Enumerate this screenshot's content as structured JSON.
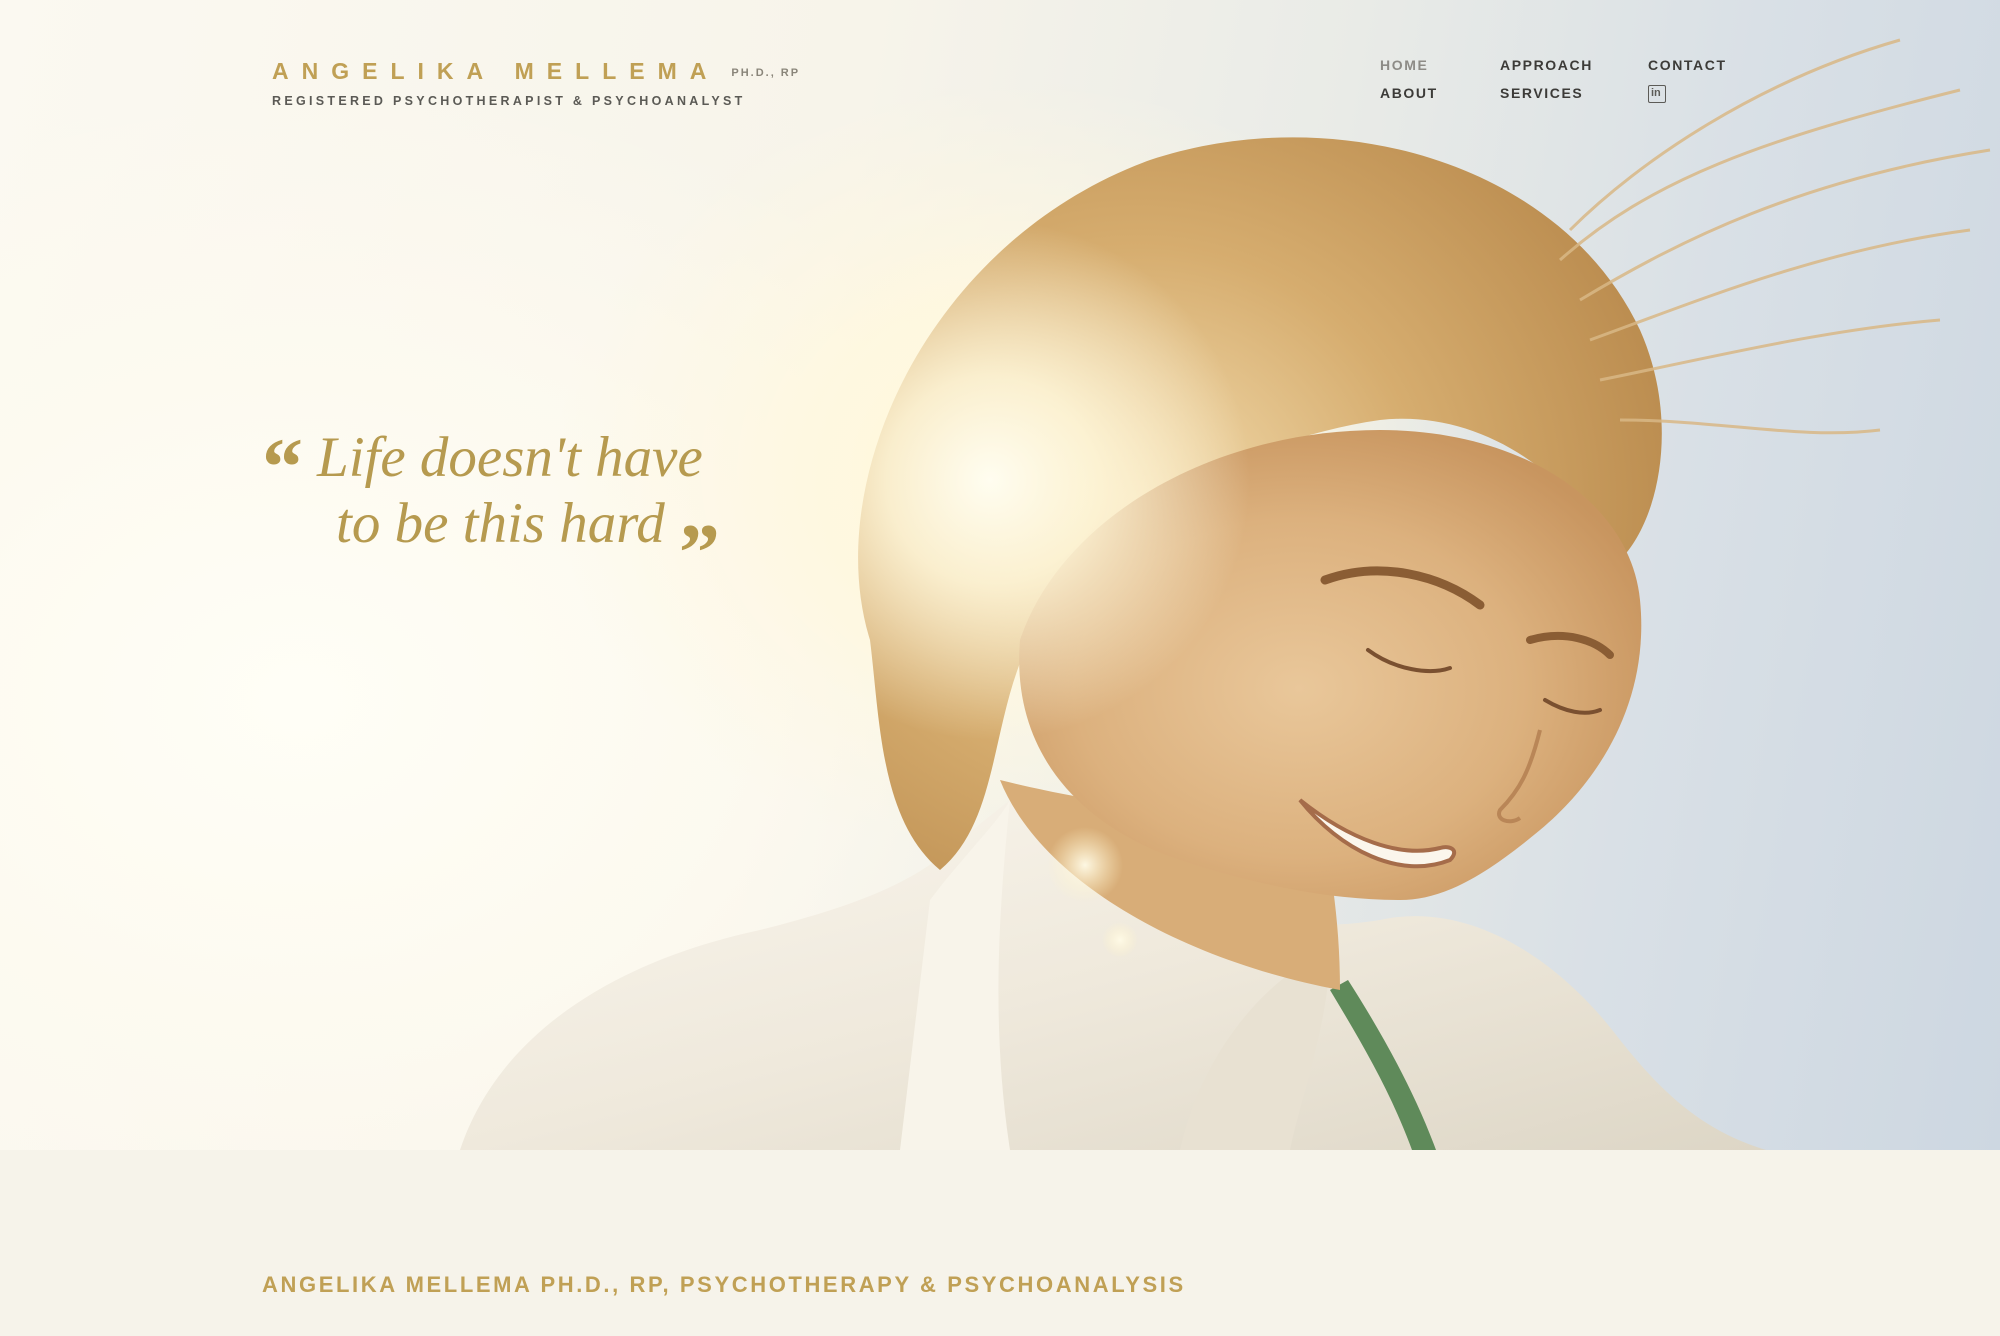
{
  "header": {
    "brand_name": "ANGELIKA MELLEMA",
    "brand_credentials": "PH.D., RP",
    "brand_subtitle": "REGISTERED PSYCHOTHERAPIST & PSYCHOANALYST"
  },
  "nav": {
    "items": [
      {
        "label": "HOME",
        "active": true
      },
      {
        "label": "APPROACH"
      },
      {
        "label": "CONTACT"
      },
      {
        "label": "ABOUT"
      },
      {
        "label": "SERVICES"
      }
    ],
    "linkedin_icon": "linkedin-icon",
    "linkedin_glyph": "in"
  },
  "hero": {
    "quote_open": "“",
    "quote_line1": "Life doesn't have",
    "quote_line2": "to be this hard",
    "quote_close": "”",
    "image": "woman-smiling-in-sunlight"
  },
  "band": {
    "title": "ANGELIKA MELLEMA PH.D., RP, PSYCHOTHERAPY & PSYCHOANALYSIS"
  },
  "colors": {
    "accent_gold": "#c0a055",
    "quote_gold": "#b69a4f",
    "nav_text": "#3c3b38",
    "nav_active": "#8d8b86",
    "band_bg": "#f6f3ea"
  }
}
